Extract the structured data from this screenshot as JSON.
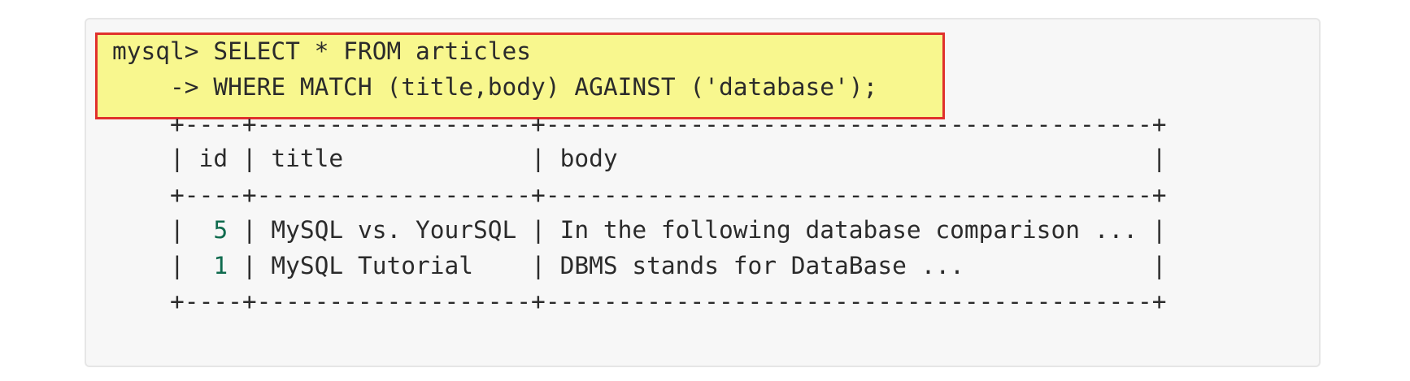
{
  "query": {
    "line1": "mysql> SELECT * FROM articles",
    "line2": "    -> WHERE MATCH (title,body) AGAINST ('database');"
  },
  "result": {
    "border": "    +----+-------------------+------------------------------------------+",
    "header": "    | id | title             | body                                     |",
    "rows": [
      {
        "prefix": "    |  ",
        "id": "5",
        "rest": " | MySQL vs. YourSQL | In the following database comparison ... |"
      },
      {
        "prefix": "    |  ",
        "id": "1",
        "rest": " | MySQL Tutorial    | DBMS stands for DataBase ...             |"
      }
    ]
  },
  "colors": {
    "highlight_fill": "#f8f78e",
    "highlight_border": "#e0312c",
    "id_number": "#0f6b4e",
    "code_background": "#f7f7f7"
  }
}
